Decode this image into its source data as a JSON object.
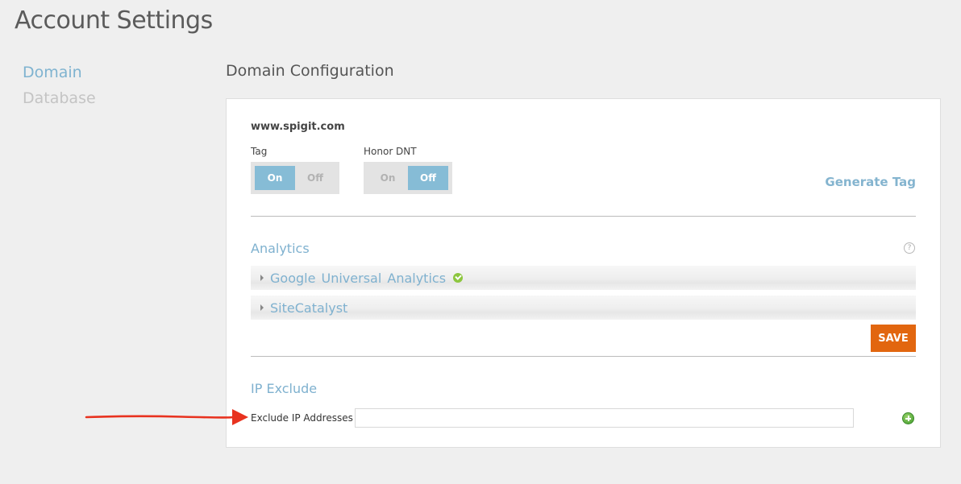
{
  "page": {
    "title": "Account Settings"
  },
  "sidebar": {
    "items": [
      {
        "label": "Domain"
      },
      {
        "label": "Database"
      }
    ]
  },
  "main": {
    "section_title": "Domain Configuration",
    "domain": "www.spigit.com",
    "tag_toggle": {
      "label": "Tag",
      "on": "On",
      "off": "Off",
      "selected": "On"
    },
    "dnt_toggle": {
      "label": "Honor DNT",
      "on": "On",
      "off": "Off",
      "selected": "Off"
    },
    "generate_tag_label": "Generate Tag",
    "analytics": {
      "heading": "Analytics",
      "help_glyph": "?",
      "providers": [
        {
          "label": "Google Universal Analytics",
          "configured": true
        },
        {
          "label": "SiteCatalyst",
          "configured": false
        }
      ],
      "save_label": "SAVE"
    },
    "ip_exclude": {
      "heading": "IP Exclude",
      "field_label": "Exclude IP Addresses",
      "field_value": ""
    }
  },
  "colors": {
    "accent": "#7fb1cf",
    "toggle_selected": "#86bcd6",
    "save": "#e2660f",
    "success": "#8dc63f",
    "annotation_arrow": "#e8321f"
  }
}
